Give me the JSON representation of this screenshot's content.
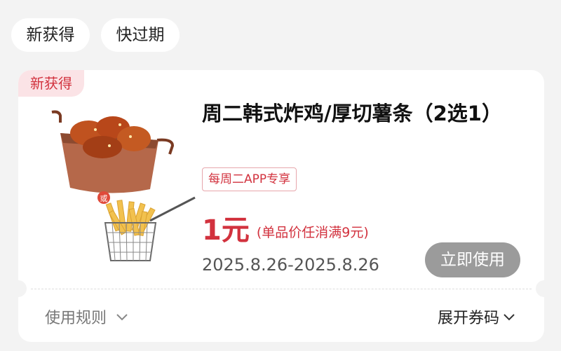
{
  "filters": [
    "新获得",
    "快过期"
  ],
  "coupon": {
    "tag": "新获得",
    "title": "周二韩式炸鸡/厚切薯条（2选1）",
    "badge": "每周二APP专享",
    "price": "1元",
    "condition": "(单品价任消满9元)",
    "date_range": "2025.8.26-2025.8.26",
    "use_button": "立即使用",
    "rules_label": "使用规则",
    "expand_label": "展开券码",
    "image_badge": "或"
  },
  "colors": {
    "accent": "#d2323e",
    "button_gray": "#9b9b9b",
    "background": "#f3f3f3"
  }
}
